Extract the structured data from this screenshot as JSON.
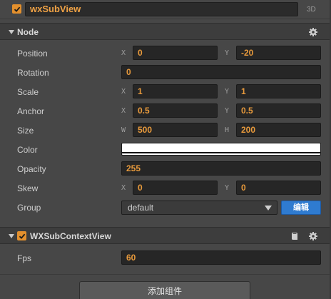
{
  "node": {
    "name": "wxSubView",
    "mode_tag": "3D",
    "enabled": true
  },
  "node_section": {
    "title": "Node",
    "collapsed": false,
    "settings_icon": "gear-icon"
  },
  "properties": {
    "position": {
      "label": "Position",
      "x_axis": "X",
      "x": "0",
      "y_axis": "Y",
      "y": "-20"
    },
    "rotation": {
      "label": "Rotation",
      "value": "0"
    },
    "scale": {
      "label": "Scale",
      "x_axis": "X",
      "x": "1",
      "y_axis": "Y",
      "y": "1"
    },
    "anchor": {
      "label": "Anchor",
      "x_axis": "X",
      "x": "0.5",
      "y_axis": "Y",
      "y": "0.5"
    },
    "size": {
      "label": "Size",
      "w_axis": "W",
      "w": "500",
      "h_axis": "H",
      "h": "200"
    },
    "color": {
      "label": "Color",
      "value": "#ffffff"
    },
    "opacity": {
      "label": "Opacity",
      "value": "255"
    },
    "skew": {
      "label": "Skew",
      "x_axis": "X",
      "x": "0",
      "y_axis": "Y",
      "y": "0"
    },
    "group": {
      "label": "Group",
      "value": "default",
      "edit_label": "编辑"
    }
  },
  "component": {
    "title": "WXSubContextView",
    "enabled": true,
    "icons": [
      "book-icon",
      "gear-icon"
    ],
    "fps_label": "Fps",
    "fps_value": "60"
  },
  "footer": {
    "add_component_label": "添加组件"
  },
  "colors": {
    "accent": "#e3902d",
    "value_text": "#e89a3c",
    "button_blue": "#2f7bd0",
    "panel_bg": "#474747"
  }
}
